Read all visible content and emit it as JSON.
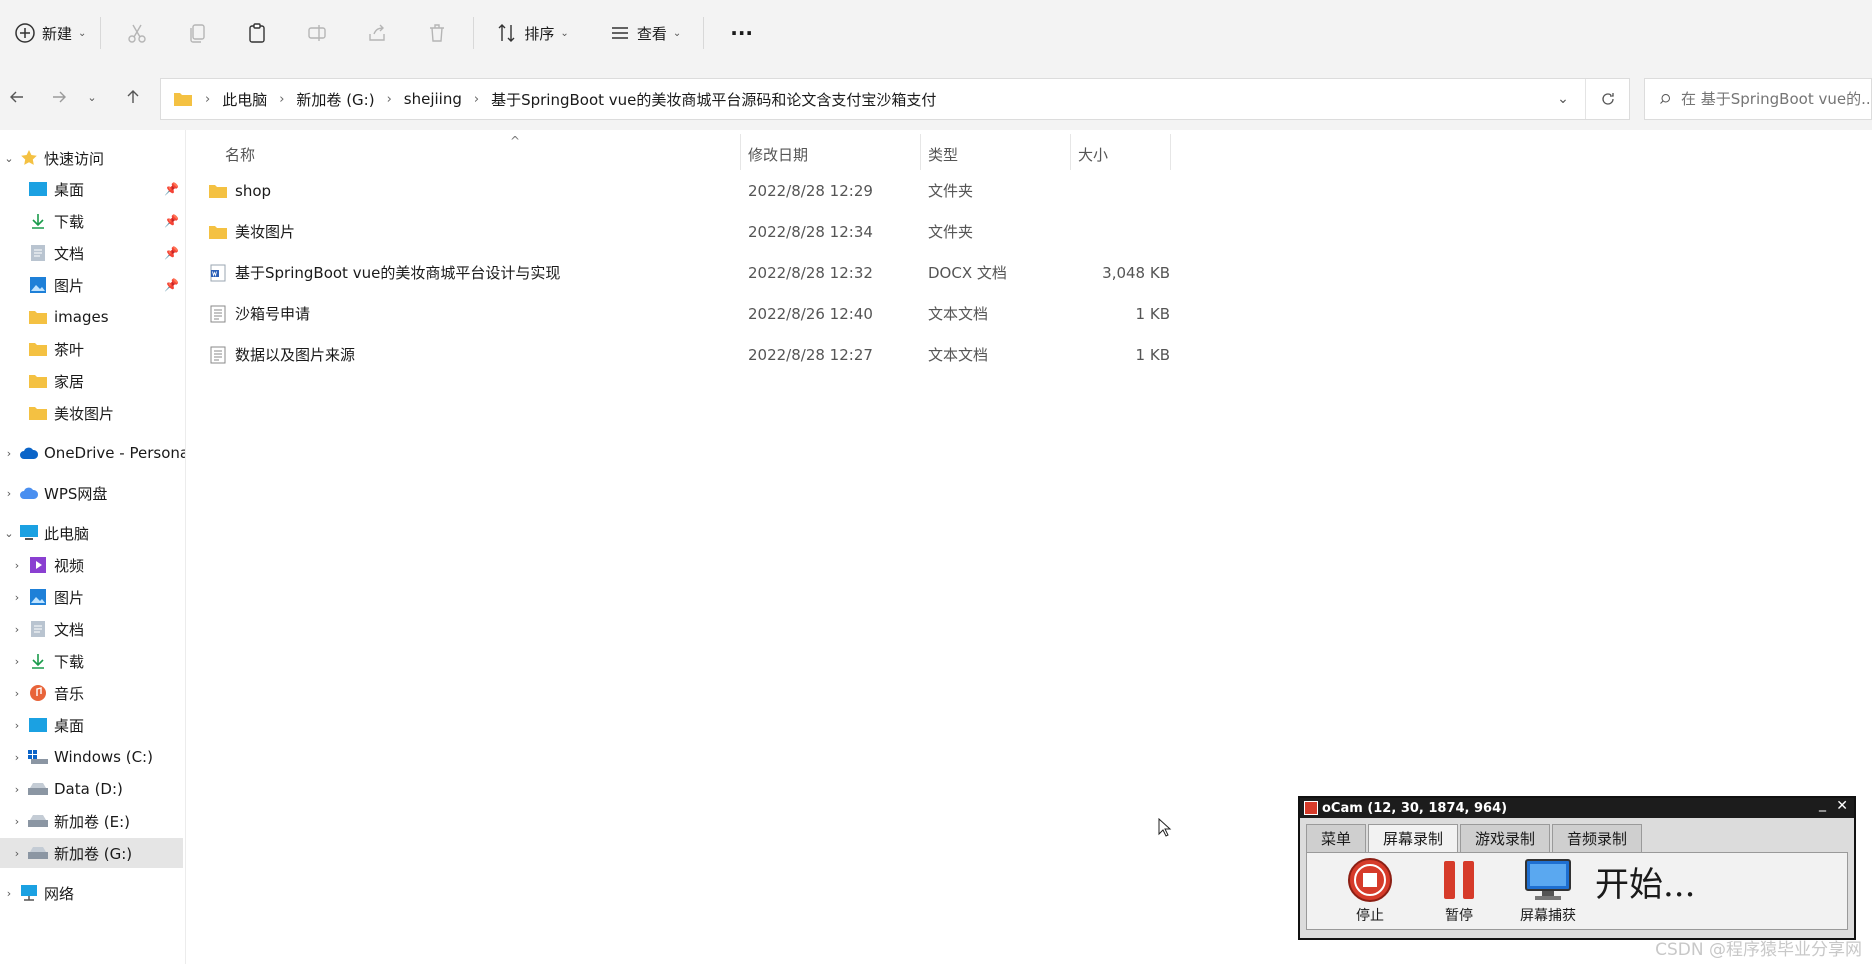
{
  "toolbar": {
    "new_label": "新建",
    "sort_label": "排序",
    "view_label": "查看",
    "more_label": "···"
  },
  "breadcrumb": [
    "此电脑",
    "新加卷 (G:)",
    "shejiing",
    "基于SpringBoot vue的美妆商城平台源码和论文含支付宝沙箱支付"
  ],
  "search": {
    "placeholder": "在 基于SpringBoot vue的..."
  },
  "sidebar": {
    "quick_access": "快速访问",
    "quick_items": [
      "桌面",
      "下载",
      "文档",
      "图片",
      "images",
      "茶叶",
      "家居",
      "美妆图片"
    ],
    "onedrive": "OneDrive - Persona",
    "wps": "WPS网盘",
    "this_pc": "此电脑",
    "pc_items": [
      "视频",
      "图片",
      "文档",
      "下载",
      "音乐",
      "桌面",
      "Windows (C:)",
      "Data (D:)",
      "新加卷 (E:)",
      "新加卷 (G:)"
    ],
    "network": "网络"
  },
  "columns": {
    "name": "名称",
    "date": "修改日期",
    "type": "类型",
    "size": "大小"
  },
  "files": [
    {
      "name": "shop",
      "date": "2022/8/28 12:29",
      "type": "文件夹",
      "size": ""
    },
    {
      "name": "美妆图片",
      "date": "2022/8/28 12:34",
      "type": "文件夹",
      "size": ""
    },
    {
      "name": "基于SpringBoot vue的美妆商城平台设计与实现",
      "date": "2022/8/28 12:32",
      "type": "DOCX 文档",
      "size": "3,048 KB"
    },
    {
      "name": "沙箱号申请",
      "date": "2022/8/26 12:40",
      "type": "文本文档",
      "size": "1 KB"
    },
    {
      "name": "数据以及图片来源",
      "date": "2022/8/28 12:27",
      "type": "文本文档",
      "size": "1 KB"
    }
  ],
  "ocam": {
    "title": "oCam (12, 30, 1874, 964)",
    "tabs": [
      "菜单",
      "屏幕录制",
      "游戏录制",
      "音频录制"
    ],
    "stop": "停止",
    "pause": "暂停",
    "capture": "屏幕捕获",
    "start": "开始..."
  },
  "watermark": "CSDN @程序猿毕业分享网",
  "colors": {
    "folder": "#f4c142",
    "accent": "#0067c0",
    "selected": "#e5e5e5",
    "ocam_red": "#d63b2a"
  }
}
